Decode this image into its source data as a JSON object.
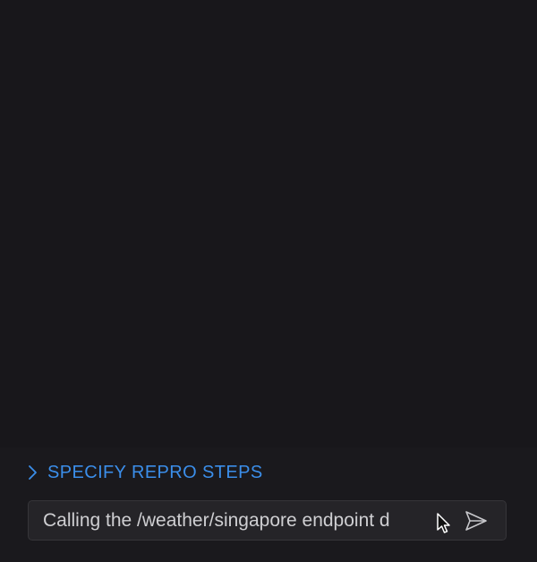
{
  "panel": {
    "repro_toggle": {
      "label": "SPECIFY REPRO STEPS",
      "icon": "chevron-right-icon",
      "expanded": false
    },
    "chat_input": {
      "value": "Calling the /weather/singapore endpoint d"
    },
    "send_button": {
      "icon": "send-icon"
    }
  },
  "colors": {
    "background": "#18171b",
    "accent": "#3b8eea",
    "input_background": "#252428",
    "input_text": "#cfcfd2"
  }
}
